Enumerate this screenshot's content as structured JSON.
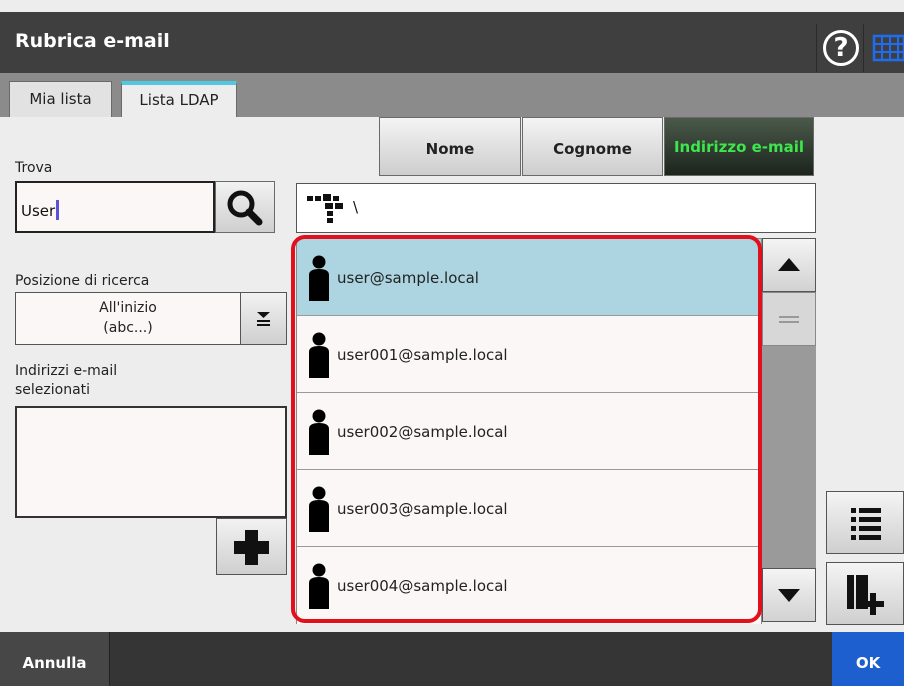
{
  "window": {
    "title": "Rubrica e-mail",
    "help_glyph": "?"
  },
  "tabs": [
    {
      "label": "Mia lista",
      "active": false
    },
    {
      "label": "Lista LDAP",
      "active": true
    }
  ],
  "left": {
    "find_label": "Trova",
    "find_value": "User",
    "position_label": "Posizione di ricerca",
    "position_value_line1": "All'inizio",
    "position_value_line2": "(abc...)",
    "selected_label_line1": "Indirizzi e-mail",
    "selected_label_line2": "selezionati"
  },
  "sort": {
    "nome": "Nome",
    "cognome": "Cognome",
    "email": "Indirizzo e-mail"
  },
  "path": {
    "text": "\\"
  },
  "list": {
    "items": [
      {
        "email": "user@sample.local",
        "selected": true
      },
      {
        "email": "user001@sample.local",
        "selected": false
      },
      {
        "email": "user002@sample.local",
        "selected": false
      },
      {
        "email": "user003@sample.local",
        "selected": false
      },
      {
        "email": "user004@sample.local",
        "selected": false
      }
    ]
  },
  "footer": {
    "cancel": "Annulla",
    "ok": "OK"
  },
  "colors": {
    "titlebar": "#3f3f3f",
    "tab_accent": "#4fc8e0",
    "selected_row": "#acd5e1",
    "highlight_border": "#e2101c",
    "active_sort_text": "#3de64d",
    "ok_button": "#1e5fd0"
  },
  "icons": [
    "help-icon",
    "keyboard-icon",
    "search-icon",
    "dropdown-icon",
    "plus-icon",
    "tree-icon",
    "person-icon",
    "arrow-up-icon",
    "scroll-thumb-icon",
    "arrow-down-icon",
    "list-icon",
    "add-group-icon"
  ]
}
